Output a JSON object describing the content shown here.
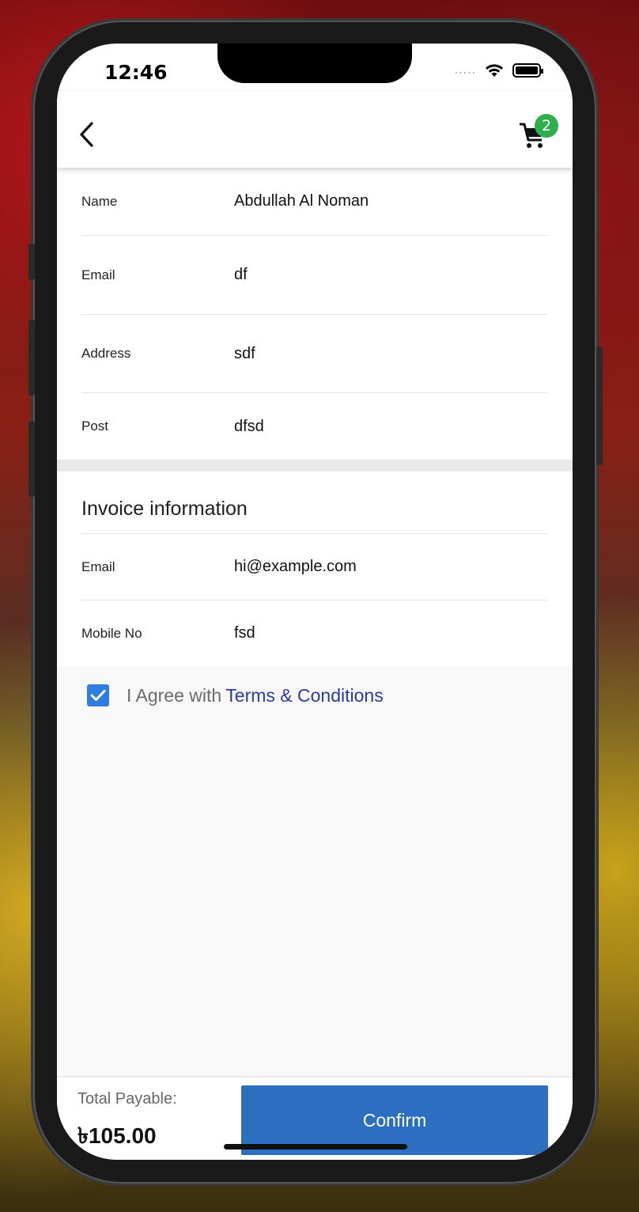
{
  "status_bar": {
    "time": "12:46",
    "signal": "....."
  },
  "header": {
    "cart_count": "2"
  },
  "form": {
    "rows": [
      {
        "label": "Name",
        "value": "Abdullah Al Noman"
      },
      {
        "label": "Email",
        "value": "df"
      },
      {
        "label": "Address",
        "value": "sdf"
      },
      {
        "label": "Post",
        "value": "dfsd"
      }
    ]
  },
  "invoice": {
    "title": "Invoice information",
    "rows": [
      {
        "label": "Email",
        "value": "hi@example.com"
      },
      {
        "label": "Mobile No",
        "value": "fsd"
      }
    ]
  },
  "agreement": {
    "checked": true,
    "prefix": "I Agree with",
    "link": "Terms & Conditions"
  },
  "footer": {
    "total_label": "Total Payable:",
    "total_amount": "৳105.00",
    "confirm_label": "Confirm"
  },
  "colors": {
    "accent": "#2c6fc1",
    "badge": "#2fae4b",
    "link": "#2b3aa0"
  }
}
